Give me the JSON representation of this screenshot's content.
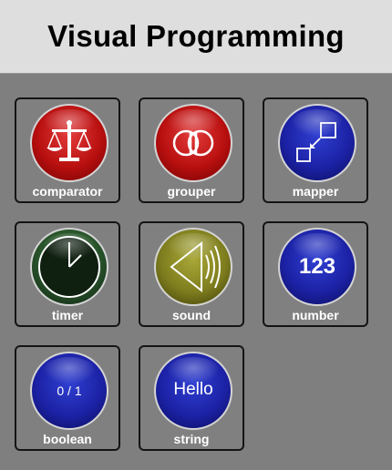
{
  "header": {
    "title": "Visual Programming"
  },
  "tiles": [
    {
      "label": "comparator",
      "icon": "scales-icon",
      "color": "#c41414"
    },
    {
      "label": "grouper",
      "icon": "overlapping-circles-icon",
      "color": "#c41414"
    },
    {
      "label": "mapper",
      "icon": "mapping-squares-icon",
      "color": "#1c22a6"
    },
    {
      "label": "timer",
      "icon": "clock-icon",
      "color": "#27512a"
    },
    {
      "label": "sound",
      "icon": "speaker-icon",
      "color": "#7f7e1f"
    },
    {
      "label": "number",
      "icon": "number-icon",
      "color": "#1c22a6",
      "glyph": "123"
    },
    {
      "label": "boolean",
      "icon": "boolean-icon",
      "color": "#1c22a6",
      "glyph": "0 / 1"
    },
    {
      "label": "string",
      "icon": "string-icon",
      "color": "#1c22a6",
      "glyph": "Hello"
    }
  ]
}
